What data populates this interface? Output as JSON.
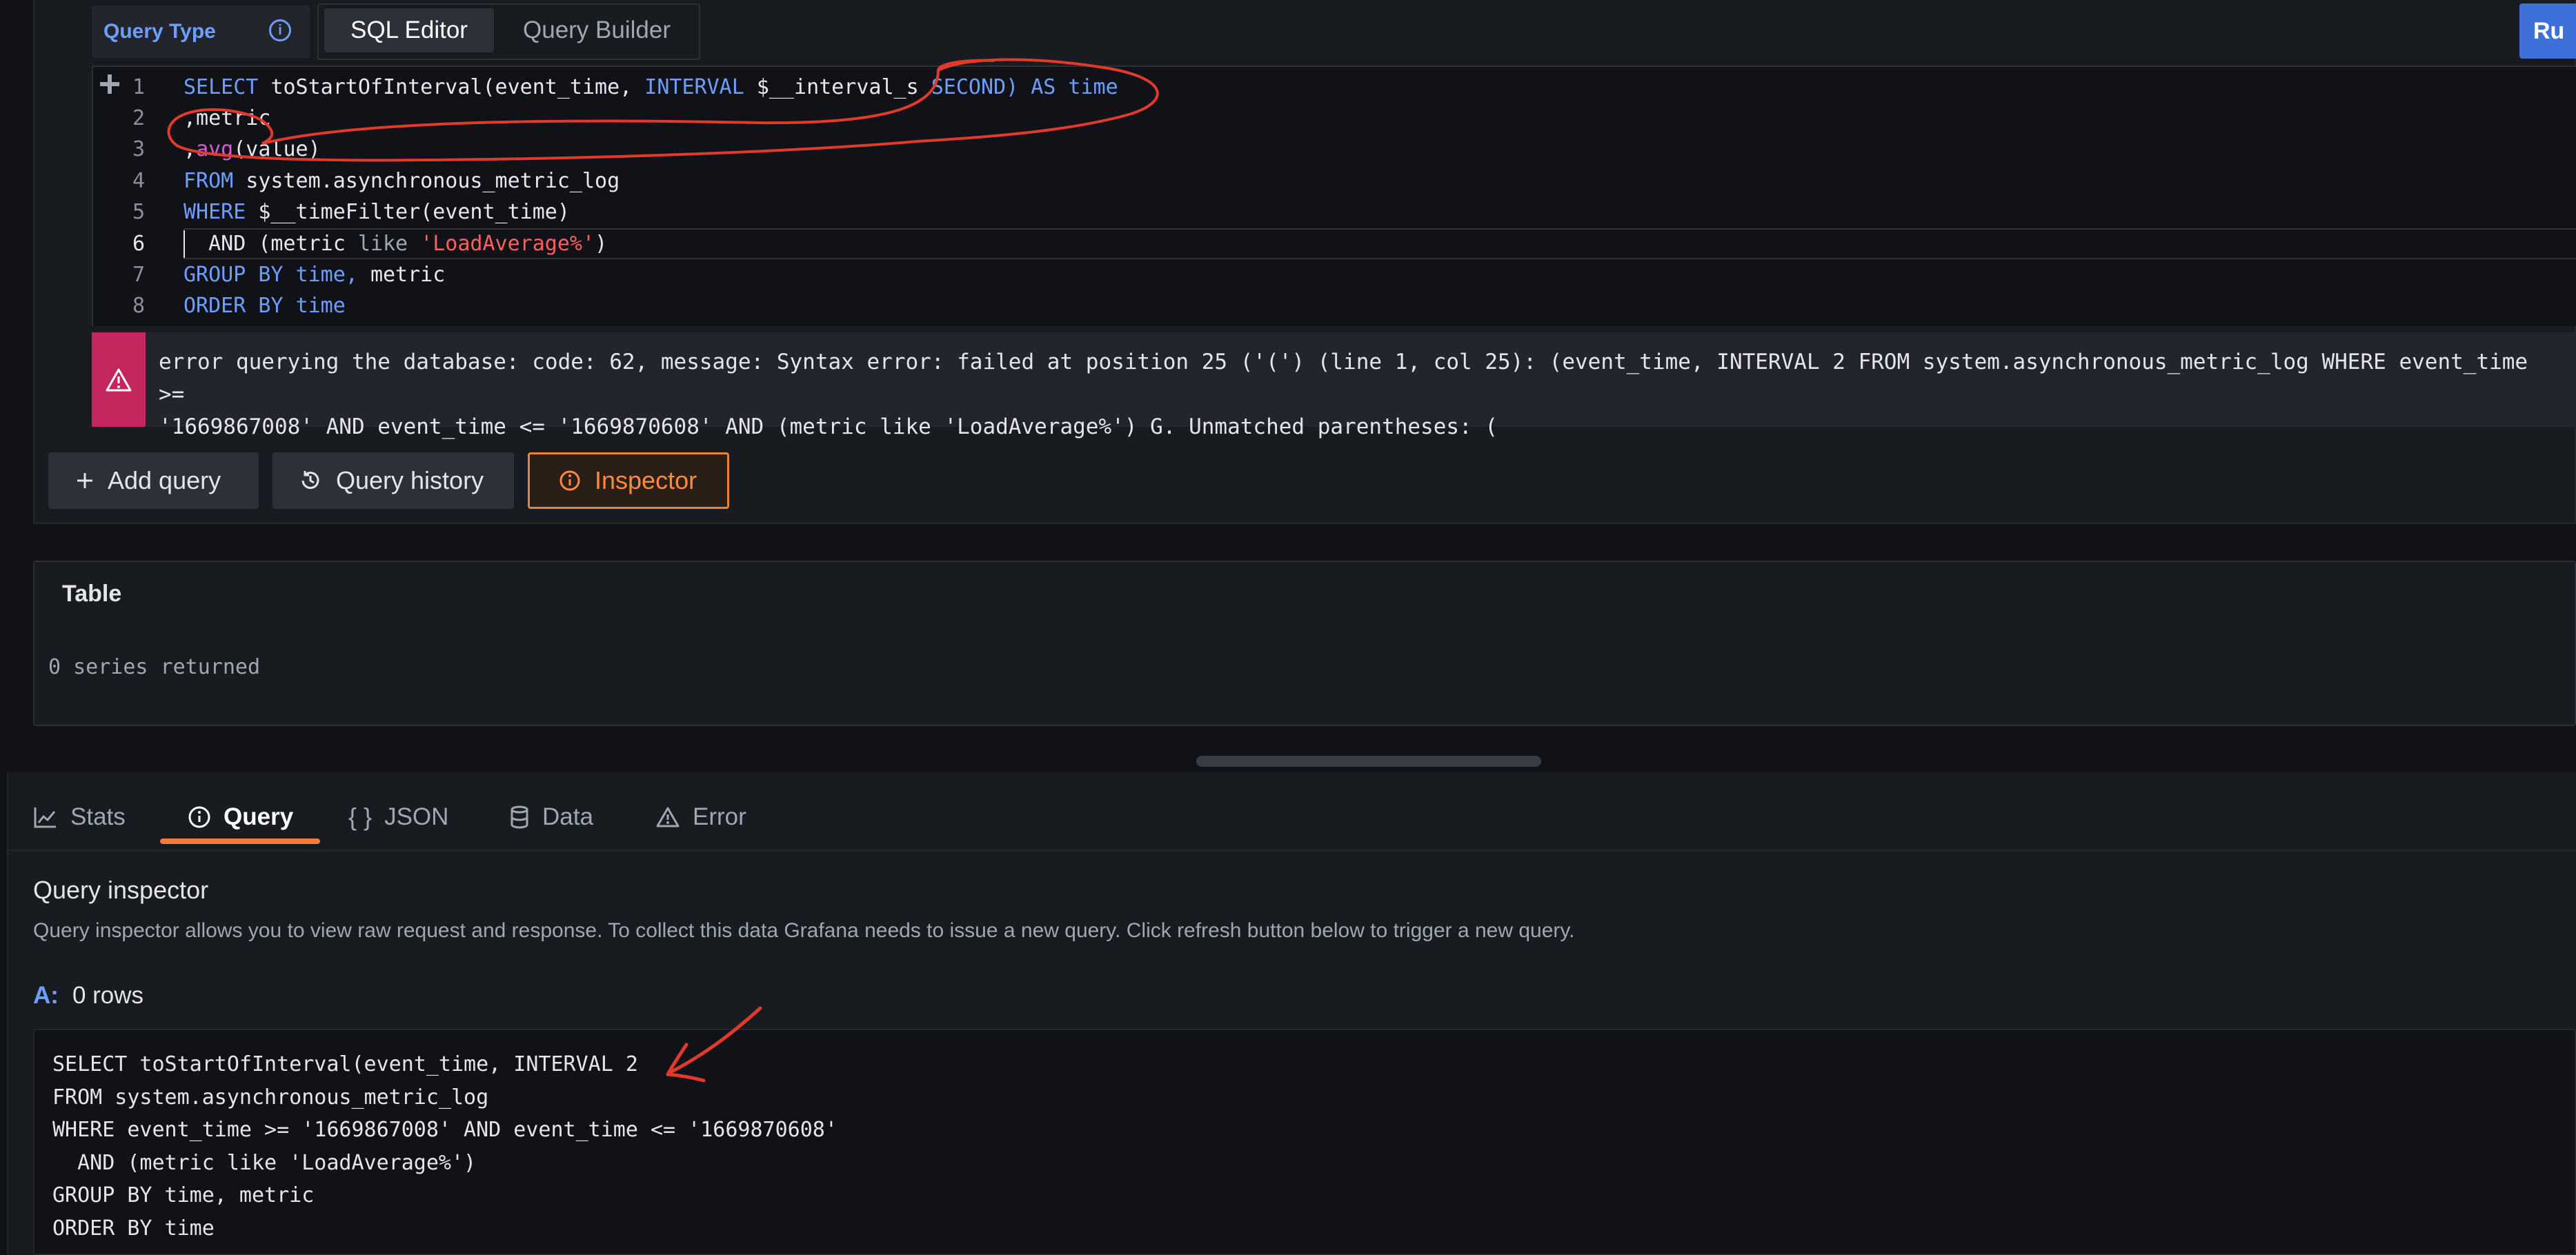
{
  "query_type": {
    "label": "Query Type",
    "modes": [
      "SQL Editor",
      "Query Builder"
    ],
    "active_mode": "SQL Editor"
  },
  "run_button": {
    "label": "Ru"
  },
  "editor": {
    "line_numbers": [
      "1",
      "2",
      "3",
      "4",
      "5",
      "6",
      "7",
      "8"
    ],
    "active_line": 6,
    "lines": [
      {
        "kw1": "SELECT",
        "t1": "toStartOfInterval(event_time,",
        "kw2": "INTERVAL",
        "t2": "$__interval_s",
        "kw3": "SECOND)",
        "kw4": "AS",
        "kw5": "time"
      },
      {
        "text": ",metric"
      },
      {
        "p": ",",
        "fn": "avg",
        "rest": "(value)"
      },
      {
        "kw": "FROM",
        "rest": "system.asynchronous_metric_log"
      },
      {
        "kw": "WHERE",
        "rest": "$__timeFilter(event_time)"
      },
      {
        "a": "AND",
        "p1": "(metric",
        "op": "like",
        "str": "'LoadAverage%'",
        "p2": ")"
      },
      {
        "kw": "GROUP BY",
        "kw2": "time,",
        "rest": "metric"
      },
      {
        "kw": "ORDER BY",
        "kw2": "time"
      }
    ]
  },
  "error": {
    "line1": "error querying the database: code: 62, message: Syntax error: failed at position 25 ('(') (line 1, col 25): (event_time, INTERVAL 2 FROM system.asynchronous_metric_log WHERE event_time >=",
    "line2": "'1669867008' AND event_time <= '1669870608' AND (metric like 'LoadAverage%') G. Unmatched parentheses: ("
  },
  "actions": {
    "add_query": "Add query",
    "query_history": "Query history",
    "inspector": "Inspector"
  },
  "table_panel": {
    "title": "Table",
    "status": "0 series returned"
  },
  "inspector": {
    "tabs": [
      "Stats",
      "Query",
      "JSON",
      "Data",
      "Error"
    ],
    "active_tab": "Query",
    "title": "Query inspector",
    "description": "Query inspector allows you to view raw request and response. To collect this data Grafana needs to issue a new query. Click refresh button below to trigger a new query.",
    "result_ref": "A:",
    "result_rows": "0 rows",
    "sql_lines": [
      "SELECT toStartOfInterval(event_time, INTERVAL 2",
      "FROM system.asynchronous_metric_log",
      "WHERE event_time >= '1669867008' AND event_time <= '1669870608'",
      "  AND (metric like 'LoadAverage%')",
      "GROUP BY time, metric",
      "ORDER BY time"
    ]
  },
  "colors": {
    "accent_blue": "#6e9fff",
    "error_red": "#c4265e",
    "inspector_orange": "#ff8a3d",
    "annotation_red": "#e23a2a"
  }
}
